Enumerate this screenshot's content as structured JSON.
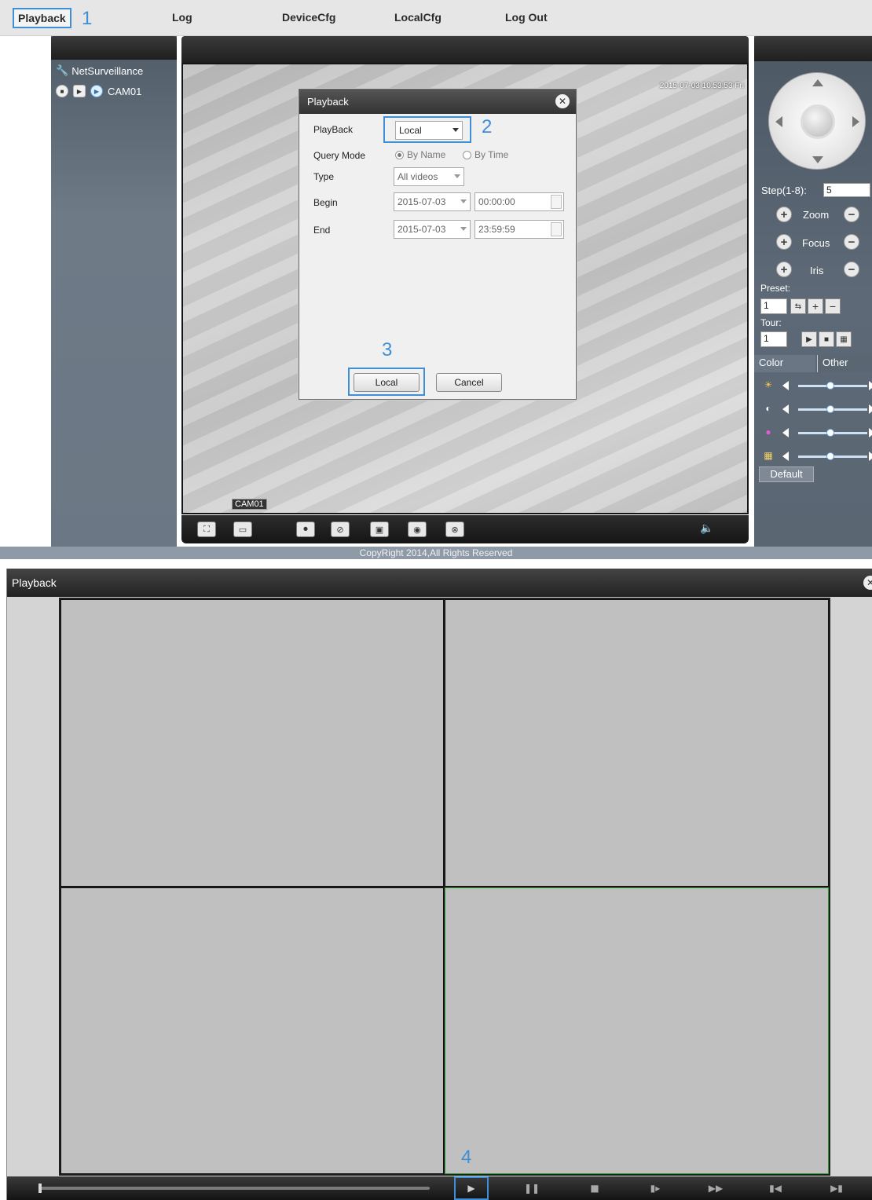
{
  "menu": {
    "items": [
      {
        "label": "Playback",
        "active": true
      },
      {
        "label": "Log"
      },
      {
        "label": "DeviceCfg"
      },
      {
        "label": "LocalCfg"
      },
      {
        "label": "Log Out"
      }
    ]
  },
  "annotations": {
    "step1": "1",
    "step2": "2",
    "step3": "3",
    "step4": "4",
    "highlight_color": "#3f8fd8"
  },
  "tree": {
    "root": "NetSurveillance",
    "camera": "CAM01"
  },
  "video": {
    "timestamp": "2015-07-03 10:53:53 Fri",
    "channel_label": "CAM01"
  },
  "dialog": {
    "title": "Playback",
    "playback_label": "PlayBack",
    "playback_value": "Local",
    "query_mode_label": "Query Mode",
    "query_mode_options": {
      "by_name": "By Name",
      "by_time": "By Time",
      "selected": "By Name"
    },
    "type_label": "Type",
    "type_value": "All videos",
    "begin_label": "Begin",
    "begin_date": "2015-07-03",
    "begin_time": "00:00:00",
    "end_label": "End",
    "end_date": "2015-07-03",
    "end_time": "23:59:59",
    "local_button": "Local",
    "cancel_button": "Cancel"
  },
  "ptz": {
    "step_label": "Step(1-8):",
    "step_value": "5",
    "zoom": "Zoom",
    "focus": "Focus",
    "iris": "Iris",
    "preset_label": "Preset:",
    "preset_value": "1",
    "tour_label": "Tour:",
    "tour_value": "1",
    "tab_color": "Color",
    "tab_other": "Other",
    "default_button": "Default"
  },
  "footer": {
    "copyright": "CopyRight 2014,All Rights Reserved"
  },
  "playback_window": {
    "title": "Playback",
    "selected_cell_color": "#2f9a2f"
  }
}
